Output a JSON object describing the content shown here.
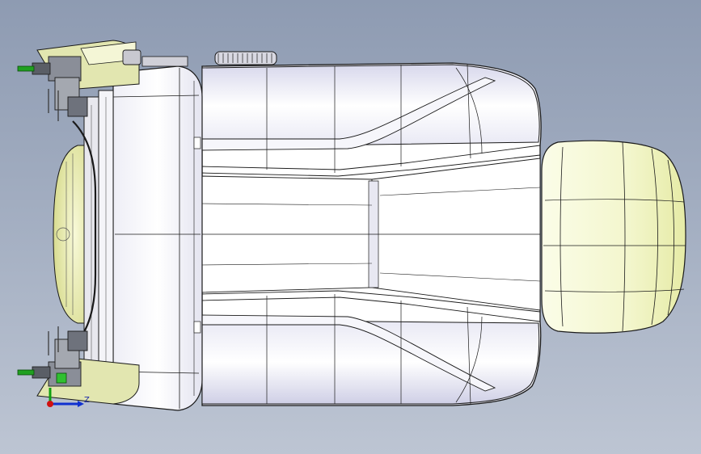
{
  "viewport": {
    "background_top": "#8e9bb2",
    "background_bottom": "#bdc5d3"
  },
  "model": {
    "body_color": "#ffffff",
    "edge_color": "#1a1a1a",
    "accent_color": "#f1f4c8"
  },
  "triad": {
    "z_label": "Z",
    "x_color": "#d01010",
    "y_color": "#10a010",
    "z_color": "#1030d0"
  }
}
